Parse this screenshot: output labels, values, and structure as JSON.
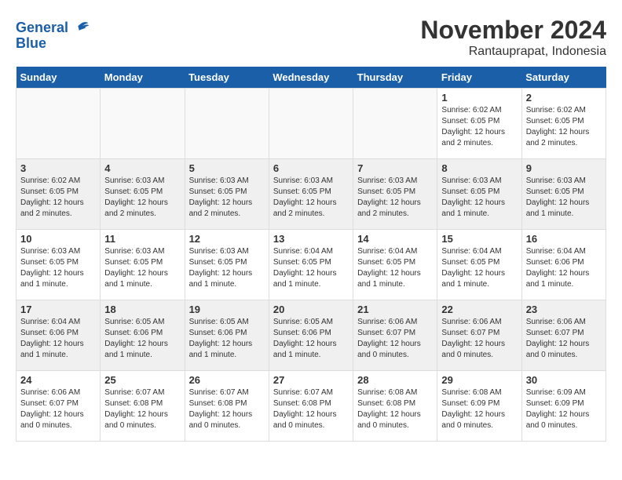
{
  "header": {
    "logo_line1": "General",
    "logo_line2": "Blue",
    "title": "November 2024",
    "subtitle": "Rantauprapat, Indonesia"
  },
  "days_of_week": [
    "Sunday",
    "Monday",
    "Tuesday",
    "Wednesday",
    "Thursday",
    "Friday",
    "Saturday"
  ],
  "weeks": [
    {
      "days": [
        {
          "number": "",
          "sunrise": "",
          "sunset": "",
          "daylight": "",
          "empty": true
        },
        {
          "number": "",
          "sunrise": "",
          "sunset": "",
          "daylight": "",
          "empty": true
        },
        {
          "number": "",
          "sunrise": "",
          "sunset": "",
          "daylight": "",
          "empty": true
        },
        {
          "number": "",
          "sunrise": "",
          "sunset": "",
          "daylight": "",
          "empty": true
        },
        {
          "number": "",
          "sunrise": "",
          "sunset": "",
          "daylight": "",
          "empty": true
        },
        {
          "number": "1",
          "sunrise": "Sunrise: 6:02 AM",
          "sunset": "Sunset: 6:05 PM",
          "daylight": "Daylight: 12 hours and 2 minutes.",
          "empty": false
        },
        {
          "number": "2",
          "sunrise": "Sunrise: 6:02 AM",
          "sunset": "Sunset: 6:05 PM",
          "daylight": "Daylight: 12 hours and 2 minutes.",
          "empty": false
        }
      ]
    },
    {
      "days": [
        {
          "number": "3",
          "sunrise": "Sunrise: 6:02 AM",
          "sunset": "Sunset: 6:05 PM",
          "daylight": "Daylight: 12 hours and 2 minutes.",
          "empty": false
        },
        {
          "number": "4",
          "sunrise": "Sunrise: 6:03 AM",
          "sunset": "Sunset: 6:05 PM",
          "daylight": "Daylight: 12 hours and 2 minutes.",
          "empty": false
        },
        {
          "number": "5",
          "sunrise": "Sunrise: 6:03 AM",
          "sunset": "Sunset: 6:05 PM",
          "daylight": "Daylight: 12 hours and 2 minutes.",
          "empty": false
        },
        {
          "number": "6",
          "sunrise": "Sunrise: 6:03 AM",
          "sunset": "Sunset: 6:05 PM",
          "daylight": "Daylight: 12 hours and 2 minutes.",
          "empty": false
        },
        {
          "number": "7",
          "sunrise": "Sunrise: 6:03 AM",
          "sunset": "Sunset: 6:05 PM",
          "daylight": "Daylight: 12 hours and 2 minutes.",
          "empty": false
        },
        {
          "number": "8",
          "sunrise": "Sunrise: 6:03 AM",
          "sunset": "Sunset: 6:05 PM",
          "daylight": "Daylight: 12 hours and 1 minute.",
          "empty": false
        },
        {
          "number": "9",
          "sunrise": "Sunrise: 6:03 AM",
          "sunset": "Sunset: 6:05 PM",
          "daylight": "Daylight: 12 hours and 1 minute.",
          "empty": false
        }
      ]
    },
    {
      "days": [
        {
          "number": "10",
          "sunrise": "Sunrise: 6:03 AM",
          "sunset": "Sunset: 6:05 PM",
          "daylight": "Daylight: 12 hours and 1 minute.",
          "empty": false
        },
        {
          "number": "11",
          "sunrise": "Sunrise: 6:03 AM",
          "sunset": "Sunset: 6:05 PM",
          "daylight": "Daylight: 12 hours and 1 minute.",
          "empty": false
        },
        {
          "number": "12",
          "sunrise": "Sunrise: 6:03 AM",
          "sunset": "Sunset: 6:05 PM",
          "daylight": "Daylight: 12 hours and 1 minute.",
          "empty": false
        },
        {
          "number": "13",
          "sunrise": "Sunrise: 6:04 AM",
          "sunset": "Sunset: 6:05 PM",
          "daylight": "Daylight: 12 hours and 1 minute.",
          "empty": false
        },
        {
          "number": "14",
          "sunrise": "Sunrise: 6:04 AM",
          "sunset": "Sunset: 6:05 PM",
          "daylight": "Daylight: 12 hours and 1 minute.",
          "empty": false
        },
        {
          "number": "15",
          "sunrise": "Sunrise: 6:04 AM",
          "sunset": "Sunset: 6:05 PM",
          "daylight": "Daylight: 12 hours and 1 minute.",
          "empty": false
        },
        {
          "number": "16",
          "sunrise": "Sunrise: 6:04 AM",
          "sunset": "Sunset: 6:06 PM",
          "daylight": "Daylight: 12 hours and 1 minute.",
          "empty": false
        }
      ]
    },
    {
      "days": [
        {
          "number": "17",
          "sunrise": "Sunrise: 6:04 AM",
          "sunset": "Sunset: 6:06 PM",
          "daylight": "Daylight: 12 hours and 1 minute.",
          "empty": false
        },
        {
          "number": "18",
          "sunrise": "Sunrise: 6:05 AM",
          "sunset": "Sunset: 6:06 PM",
          "daylight": "Daylight: 12 hours and 1 minute.",
          "empty": false
        },
        {
          "number": "19",
          "sunrise": "Sunrise: 6:05 AM",
          "sunset": "Sunset: 6:06 PM",
          "daylight": "Daylight: 12 hours and 1 minute.",
          "empty": false
        },
        {
          "number": "20",
          "sunrise": "Sunrise: 6:05 AM",
          "sunset": "Sunset: 6:06 PM",
          "daylight": "Daylight: 12 hours and 1 minute.",
          "empty": false
        },
        {
          "number": "21",
          "sunrise": "Sunrise: 6:06 AM",
          "sunset": "Sunset: 6:07 PM",
          "daylight": "Daylight: 12 hours and 0 minutes.",
          "empty": false
        },
        {
          "number": "22",
          "sunrise": "Sunrise: 6:06 AM",
          "sunset": "Sunset: 6:07 PM",
          "daylight": "Daylight: 12 hours and 0 minutes.",
          "empty": false
        },
        {
          "number": "23",
          "sunrise": "Sunrise: 6:06 AM",
          "sunset": "Sunset: 6:07 PM",
          "daylight": "Daylight: 12 hours and 0 minutes.",
          "empty": false
        }
      ]
    },
    {
      "days": [
        {
          "number": "24",
          "sunrise": "Sunrise: 6:06 AM",
          "sunset": "Sunset: 6:07 PM",
          "daylight": "Daylight: 12 hours and 0 minutes.",
          "empty": false
        },
        {
          "number": "25",
          "sunrise": "Sunrise: 6:07 AM",
          "sunset": "Sunset: 6:08 PM",
          "daylight": "Daylight: 12 hours and 0 minutes.",
          "empty": false
        },
        {
          "number": "26",
          "sunrise": "Sunrise: 6:07 AM",
          "sunset": "Sunset: 6:08 PM",
          "daylight": "Daylight: 12 hours and 0 minutes.",
          "empty": false
        },
        {
          "number": "27",
          "sunrise": "Sunrise: 6:07 AM",
          "sunset": "Sunset: 6:08 PM",
          "daylight": "Daylight: 12 hours and 0 minutes.",
          "empty": false
        },
        {
          "number": "28",
          "sunrise": "Sunrise: 6:08 AM",
          "sunset": "Sunset: 6:08 PM",
          "daylight": "Daylight: 12 hours and 0 minutes.",
          "empty": false
        },
        {
          "number": "29",
          "sunrise": "Sunrise: 6:08 AM",
          "sunset": "Sunset: 6:09 PM",
          "daylight": "Daylight: 12 hours and 0 minutes.",
          "empty": false
        },
        {
          "number": "30",
          "sunrise": "Sunrise: 6:09 AM",
          "sunset": "Sunset: 6:09 PM",
          "daylight": "Daylight: 12 hours and 0 minutes.",
          "empty": false
        }
      ]
    }
  ]
}
